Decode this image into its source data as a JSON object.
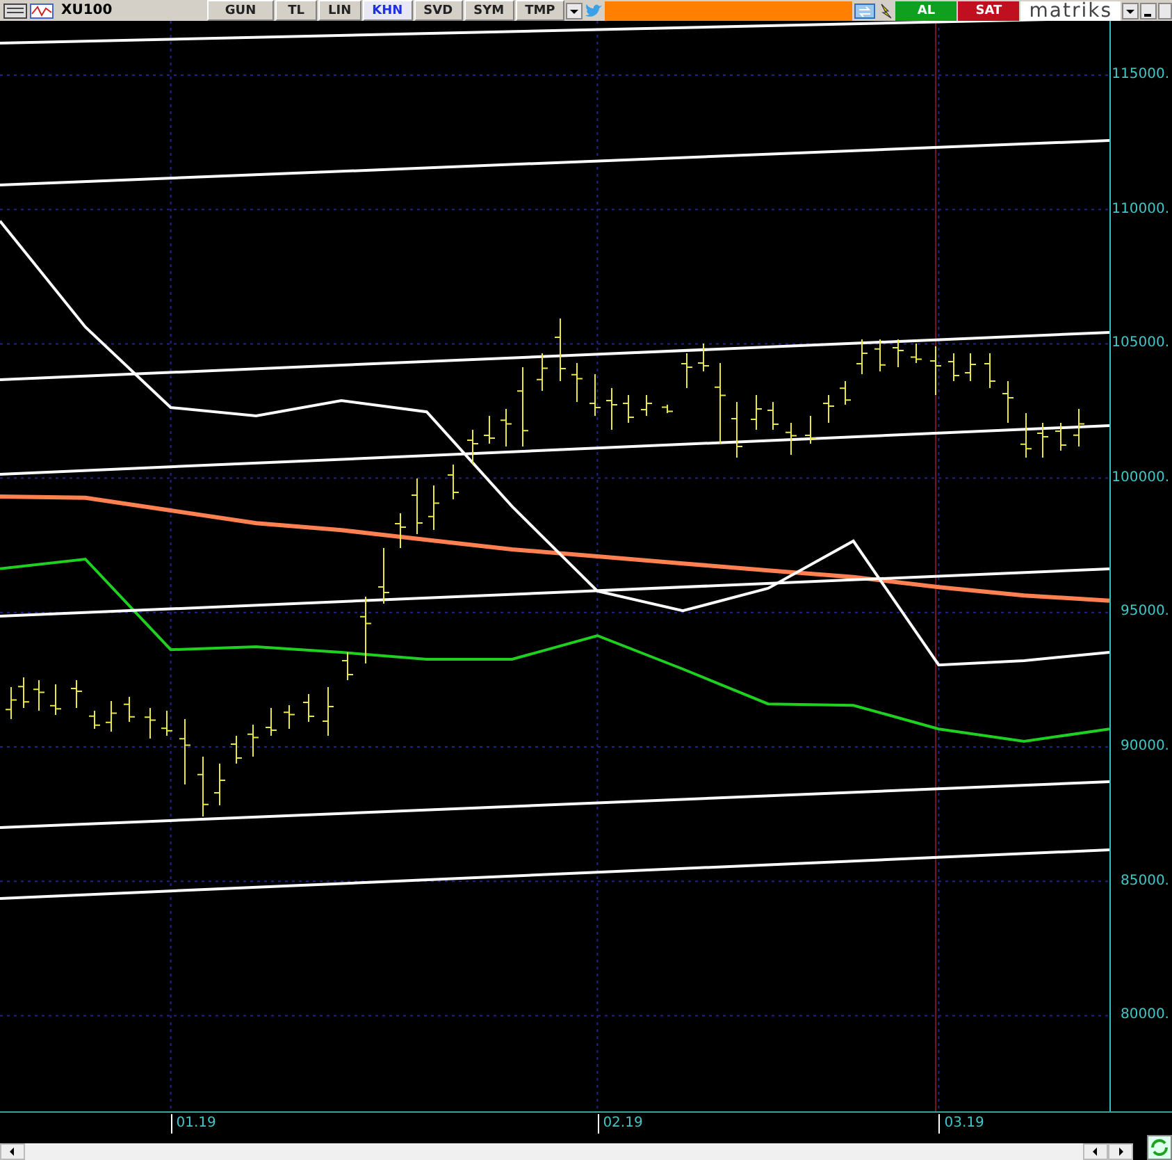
{
  "toolbar": {
    "symbol": "XU100",
    "buttons": [
      {
        "label": "GUN",
        "selected": false
      },
      {
        "label": "TL",
        "selected": false
      },
      {
        "label": "LIN",
        "selected": false
      },
      {
        "label": "KHN",
        "selected": true
      },
      {
        "label": "SVD",
        "selected": false
      },
      {
        "label": "SYM",
        "selected": false
      },
      {
        "label": "TMP",
        "selected": false
      }
    ],
    "trade_buttons": [
      {
        "label": "AL",
        "kind": "buy"
      },
      {
        "label": "SAT",
        "kind": "sell"
      }
    ],
    "logo": "matriks"
  },
  "chart": {
    "chart_data": {
      "type": "line",
      "categories": [
        null,
        null,
        "01.19",
        null,
        null,
        null,
        null,
        "02.19",
        null,
        null,
        null,
        "03.19",
        null,
        null
      ],
      "series": [
        {
          "color": "#20d020",
          "values": [
            96630,
            96990,
            93620,
            93730,
            93520,
            93260,
            93260,
            94140,
            92900,
            91600,
            91550,
            90670,
            90210,
            90670
          ]
        },
        {
          "color": "#ff8050",
          "values": [
            99320,
            99270,
            98800,
            98330,
            98070,
            97710,
            97350,
            97090,
            96830,
            96570,
            96320,
            95950,
            95640,
            95440
          ]
        },
        {
          "color": "#ffffff",
          "values": [
            109570,
            105630,
            102630,
            102320,
            102890,
            102470,
            98950,
            95800,
            95070,
            95900,
            97660,
            93050,
            93210,
            93520
          ]
        }
      ],
      "ylim": [
        76440,
        117020
      ],
      "grid": true,
      "yticks": [
        {
          "value": 115000,
          "label": "115000."
        },
        {
          "value": 110000,
          "label": "110000."
        },
        {
          "value": 105000,
          "label": "105000."
        },
        {
          "value": 100000,
          "label": "100000."
        },
        {
          "value": 95000,
          "label": "95000."
        },
        {
          "value": 90000,
          "label": "90000."
        },
        {
          "value": 85000,
          "label": "85000."
        },
        {
          "value": 80000,
          "label": "80000."
        }
      ]
    }
  }
}
